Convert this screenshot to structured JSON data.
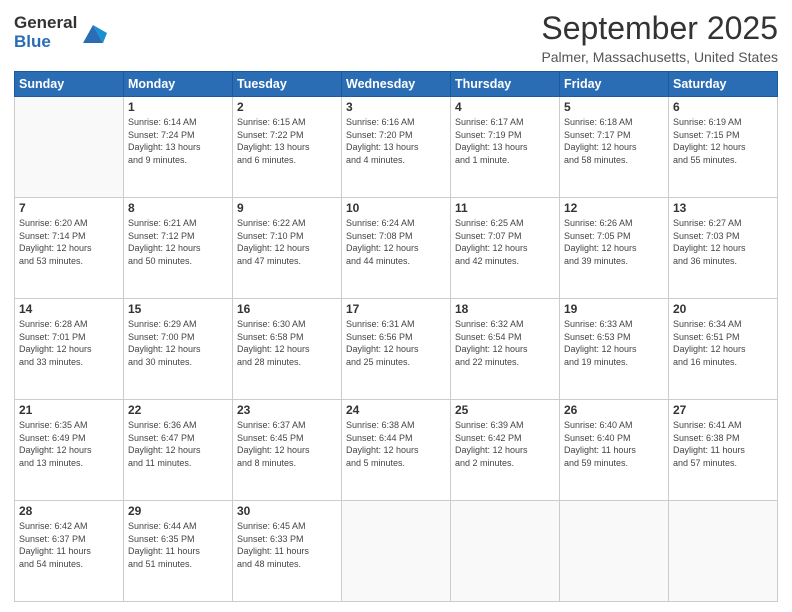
{
  "logo": {
    "general": "General",
    "blue": "Blue"
  },
  "header": {
    "month": "September 2025",
    "location": "Palmer, Massachusetts, United States"
  },
  "days_of_week": [
    "Sunday",
    "Monday",
    "Tuesday",
    "Wednesday",
    "Thursday",
    "Friday",
    "Saturday"
  ],
  "weeks": [
    [
      {
        "day": "",
        "info": ""
      },
      {
        "day": "1",
        "info": "Sunrise: 6:14 AM\nSunset: 7:24 PM\nDaylight: 13 hours\nand 9 minutes."
      },
      {
        "day": "2",
        "info": "Sunrise: 6:15 AM\nSunset: 7:22 PM\nDaylight: 13 hours\nand 6 minutes."
      },
      {
        "day": "3",
        "info": "Sunrise: 6:16 AM\nSunset: 7:20 PM\nDaylight: 13 hours\nand 4 minutes."
      },
      {
        "day": "4",
        "info": "Sunrise: 6:17 AM\nSunset: 7:19 PM\nDaylight: 13 hours\nand 1 minute."
      },
      {
        "day": "5",
        "info": "Sunrise: 6:18 AM\nSunset: 7:17 PM\nDaylight: 12 hours\nand 58 minutes."
      },
      {
        "day": "6",
        "info": "Sunrise: 6:19 AM\nSunset: 7:15 PM\nDaylight: 12 hours\nand 55 minutes."
      }
    ],
    [
      {
        "day": "7",
        "info": "Sunrise: 6:20 AM\nSunset: 7:14 PM\nDaylight: 12 hours\nand 53 minutes."
      },
      {
        "day": "8",
        "info": "Sunrise: 6:21 AM\nSunset: 7:12 PM\nDaylight: 12 hours\nand 50 minutes."
      },
      {
        "day": "9",
        "info": "Sunrise: 6:22 AM\nSunset: 7:10 PM\nDaylight: 12 hours\nand 47 minutes."
      },
      {
        "day": "10",
        "info": "Sunrise: 6:24 AM\nSunset: 7:08 PM\nDaylight: 12 hours\nand 44 minutes."
      },
      {
        "day": "11",
        "info": "Sunrise: 6:25 AM\nSunset: 7:07 PM\nDaylight: 12 hours\nand 42 minutes."
      },
      {
        "day": "12",
        "info": "Sunrise: 6:26 AM\nSunset: 7:05 PM\nDaylight: 12 hours\nand 39 minutes."
      },
      {
        "day": "13",
        "info": "Sunrise: 6:27 AM\nSunset: 7:03 PM\nDaylight: 12 hours\nand 36 minutes."
      }
    ],
    [
      {
        "day": "14",
        "info": "Sunrise: 6:28 AM\nSunset: 7:01 PM\nDaylight: 12 hours\nand 33 minutes."
      },
      {
        "day": "15",
        "info": "Sunrise: 6:29 AM\nSunset: 7:00 PM\nDaylight: 12 hours\nand 30 minutes."
      },
      {
        "day": "16",
        "info": "Sunrise: 6:30 AM\nSunset: 6:58 PM\nDaylight: 12 hours\nand 28 minutes."
      },
      {
        "day": "17",
        "info": "Sunrise: 6:31 AM\nSunset: 6:56 PM\nDaylight: 12 hours\nand 25 minutes."
      },
      {
        "day": "18",
        "info": "Sunrise: 6:32 AM\nSunset: 6:54 PM\nDaylight: 12 hours\nand 22 minutes."
      },
      {
        "day": "19",
        "info": "Sunrise: 6:33 AM\nSunset: 6:53 PM\nDaylight: 12 hours\nand 19 minutes."
      },
      {
        "day": "20",
        "info": "Sunrise: 6:34 AM\nSunset: 6:51 PM\nDaylight: 12 hours\nand 16 minutes."
      }
    ],
    [
      {
        "day": "21",
        "info": "Sunrise: 6:35 AM\nSunset: 6:49 PM\nDaylight: 12 hours\nand 13 minutes."
      },
      {
        "day": "22",
        "info": "Sunrise: 6:36 AM\nSunset: 6:47 PM\nDaylight: 12 hours\nand 11 minutes."
      },
      {
        "day": "23",
        "info": "Sunrise: 6:37 AM\nSunset: 6:45 PM\nDaylight: 12 hours\nand 8 minutes."
      },
      {
        "day": "24",
        "info": "Sunrise: 6:38 AM\nSunset: 6:44 PM\nDaylight: 12 hours\nand 5 minutes."
      },
      {
        "day": "25",
        "info": "Sunrise: 6:39 AM\nSunset: 6:42 PM\nDaylight: 12 hours\nand 2 minutes."
      },
      {
        "day": "26",
        "info": "Sunrise: 6:40 AM\nSunset: 6:40 PM\nDaylight: 11 hours\nand 59 minutes."
      },
      {
        "day": "27",
        "info": "Sunrise: 6:41 AM\nSunset: 6:38 PM\nDaylight: 11 hours\nand 57 minutes."
      }
    ],
    [
      {
        "day": "28",
        "info": "Sunrise: 6:42 AM\nSunset: 6:37 PM\nDaylight: 11 hours\nand 54 minutes."
      },
      {
        "day": "29",
        "info": "Sunrise: 6:44 AM\nSunset: 6:35 PM\nDaylight: 11 hours\nand 51 minutes."
      },
      {
        "day": "30",
        "info": "Sunrise: 6:45 AM\nSunset: 6:33 PM\nDaylight: 11 hours\nand 48 minutes."
      },
      {
        "day": "",
        "info": ""
      },
      {
        "day": "",
        "info": ""
      },
      {
        "day": "",
        "info": ""
      },
      {
        "day": "",
        "info": ""
      }
    ]
  ]
}
